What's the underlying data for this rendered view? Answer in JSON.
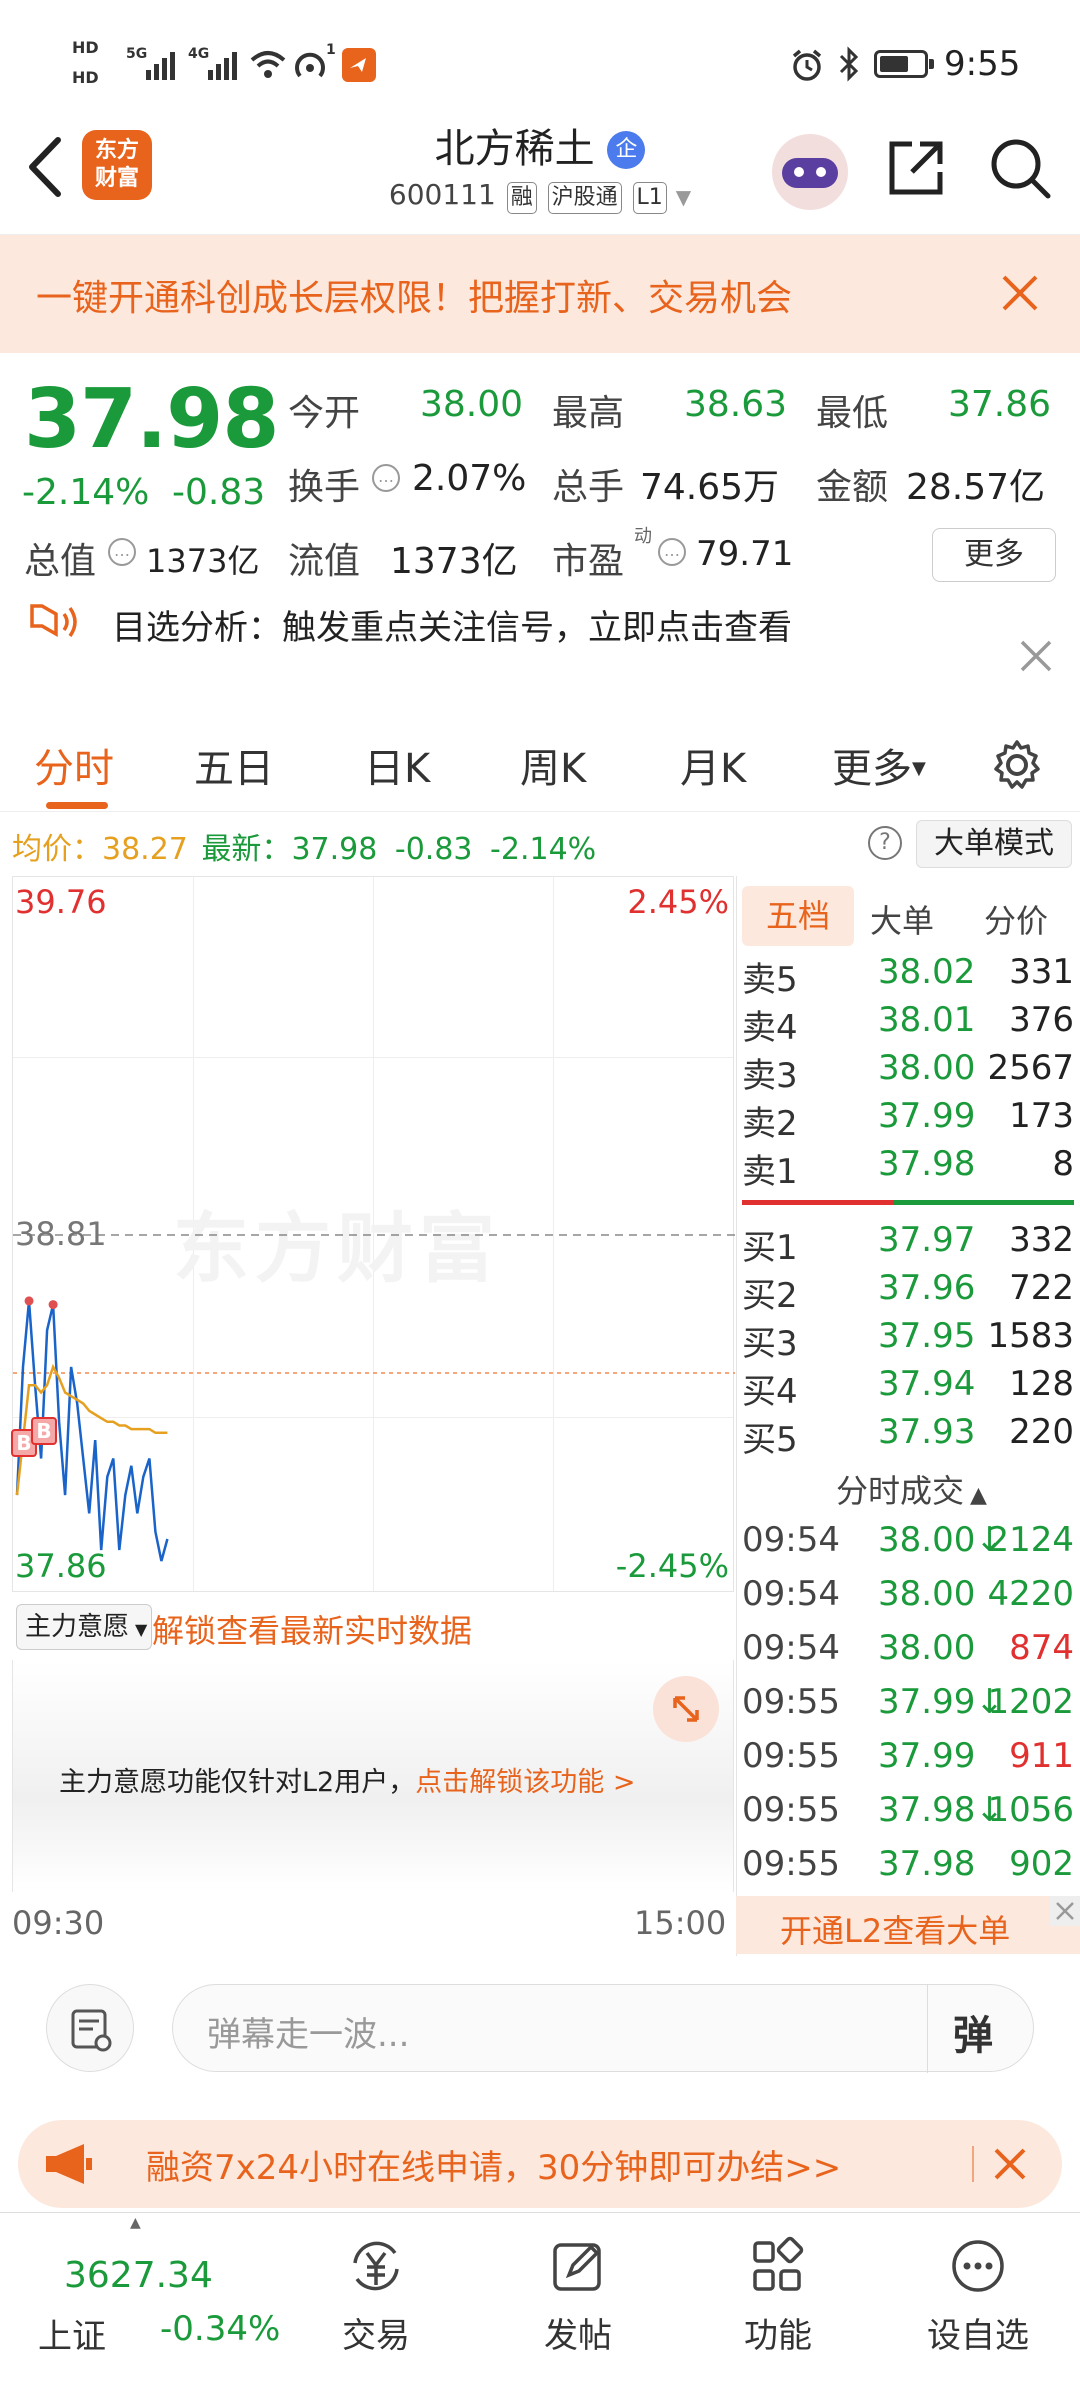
{
  "status": {
    "time": "9:55",
    "hd1": "HD",
    "hd2": "HD",
    "net1": "5G",
    "net2": "4G",
    "hotspot_count": "1"
  },
  "header": {
    "logo_line1": "东方",
    "logo_line2": "财富",
    "stock_name": "北方稀土",
    "badge": "企",
    "code": "600111",
    "tags": [
      "融",
      "沪股通",
      "L1"
    ]
  },
  "banner": {
    "text": "一键开通科创成长层权限！把握打新、交易机会"
  },
  "quote": {
    "price": "37.98",
    "change_pct": "-2.14%",
    "change": "-0.83",
    "open_label": "今开",
    "open": "38.00",
    "high_label": "最高",
    "high": "38.63",
    "low_label": "最低",
    "low": "37.86",
    "turnover_label": "换手",
    "turnover": "2.07%",
    "volume_label": "总手",
    "volume": "74.65万",
    "amount_label": "金额",
    "amount": "28.57亿",
    "mktcap_label": "总值",
    "mktcap": "1373亿",
    "float_label": "流值",
    "float": "1373亿",
    "pe_label": "市盈",
    "pe_sup": "动",
    "pe": "79.71",
    "more": "更多"
  },
  "signal": {
    "text": "目选分析：触发重点关注信号，立即点击查看"
  },
  "tabs": [
    "分时",
    "五日",
    "日K",
    "周K",
    "月K",
    "更多"
  ],
  "info_line": {
    "avg_label": "均价：",
    "avg": "38.27",
    "latest_label": "最新：",
    "latest": "37.98",
    "chg": "-0.83",
    "pct": "-2.14%",
    "mode_btn": "大单模式",
    "help": "?"
  },
  "chart": {
    "top_price": "39.76",
    "top_pct": "2.45%",
    "mid_price": "38.81",
    "bot_price": "37.86",
    "bot_pct": "-2.45%",
    "watermark": "东方财富",
    "time_start": "09:30",
    "time_end": "15:00",
    "marker": "B"
  },
  "chart_data": {
    "type": "line",
    "x": [
      "09:30",
      "09:31",
      "09:32",
      "09:33",
      "09:34",
      "09:35",
      "09:36",
      "09:37",
      "09:38",
      "09:39",
      "09:40",
      "09:41",
      "09:42",
      "09:43",
      "09:44",
      "09:45",
      "09:46",
      "09:47",
      "09:48",
      "09:49",
      "09:50",
      "09:51",
      "09:52",
      "09:53",
      "09:54",
      "09:55"
    ],
    "series": [
      {
        "values": [
          38.1,
          38.45,
          38.63,
          38.4,
          38.2,
          38.55,
          38.62,
          38.3,
          38.1,
          38.45,
          38.35,
          38.2,
          38.05,
          38.25,
          37.95,
          38.15,
          38.2,
          37.95,
          38.1,
          38.18,
          38.05,
          38.15,
          38.2,
          38.0,
          37.92,
          37.98
        ]
      },
      {
        "values": [
          38.1,
          38.25,
          38.4,
          38.4,
          38.38,
          38.4,
          38.45,
          38.42,
          38.38,
          38.37,
          38.36,
          38.35,
          38.33,
          38.32,
          38.31,
          38.3,
          38.3,
          38.29,
          38.29,
          38.28,
          38.28,
          38.28,
          38.28,
          38.27,
          38.27,
          38.27
        ]
      }
    ],
    "ylim": [
      37.86,
      39.76
    ],
    "prev_close": 38.81
  },
  "orderbook": {
    "tabs": [
      "五档",
      "大单",
      "分价"
    ],
    "sell": [
      {
        "label": "卖5",
        "price": "38.02",
        "vol": "331"
      },
      {
        "label": "卖4",
        "price": "38.01",
        "vol": "376"
      },
      {
        "label": "卖3",
        "price": "38.00",
        "vol": "2567"
      },
      {
        "label": "卖2",
        "price": "37.99",
        "vol": "173"
      },
      {
        "label": "卖1",
        "price": "37.98",
        "vol": "8"
      }
    ],
    "buy": [
      {
        "label": "买1",
        "price": "37.97",
        "vol": "332"
      },
      {
        "label": "买2",
        "price": "37.96",
        "vol": "722"
      },
      {
        "label": "买3",
        "price": "37.95",
        "vol": "1583"
      },
      {
        "label": "买4",
        "price": "37.94",
        "vol": "128"
      },
      {
        "label": "买5",
        "price": "37.93",
        "vol": "220"
      }
    ],
    "ticks_title": "分时成交",
    "ticks": [
      {
        "time": "09:54",
        "price": "38.00↓",
        "vol": "2124",
        "vc": "green"
      },
      {
        "time": "09:54",
        "price": "38.00",
        "vol": "4220",
        "vc": "green"
      },
      {
        "time": "09:54",
        "price": "38.00",
        "vol": "874",
        "vc": "red"
      },
      {
        "time": "09:55",
        "price": "37.99↓",
        "vol": "1202",
        "vc": "green"
      },
      {
        "time": "09:55",
        "price": "37.99",
        "vol": "911",
        "vc": "red"
      },
      {
        "time": "09:55",
        "price": "37.98↓",
        "vol": "1056",
        "vc": "green"
      },
      {
        "time": "09:55",
        "price": "37.98",
        "vol": "902",
        "vc": "green"
      }
    ],
    "l2_btn": "开通L2查看大单"
  },
  "main_force": {
    "select": "主力意愿",
    "unlock": "解锁查看最新实时数据",
    "note": "主力意愿功能仅针对L2用户，",
    "note_link": "点击解锁该功能 >"
  },
  "input": {
    "placeholder": "弹幕走一波...",
    "send": "弹"
  },
  "ad": {
    "text": "融资7x24小时在线申请，30分钟即可办结>>"
  },
  "bottom_nav": {
    "index_value": "3627.34",
    "index_name": "上证",
    "index_chg": "-0.34%",
    "items": [
      "交易",
      "发帖",
      "功能",
      "设自选"
    ]
  },
  "colors": {
    "accent": "#e8631c",
    "up": "#e03030",
    "down": "#1a9a3a"
  }
}
